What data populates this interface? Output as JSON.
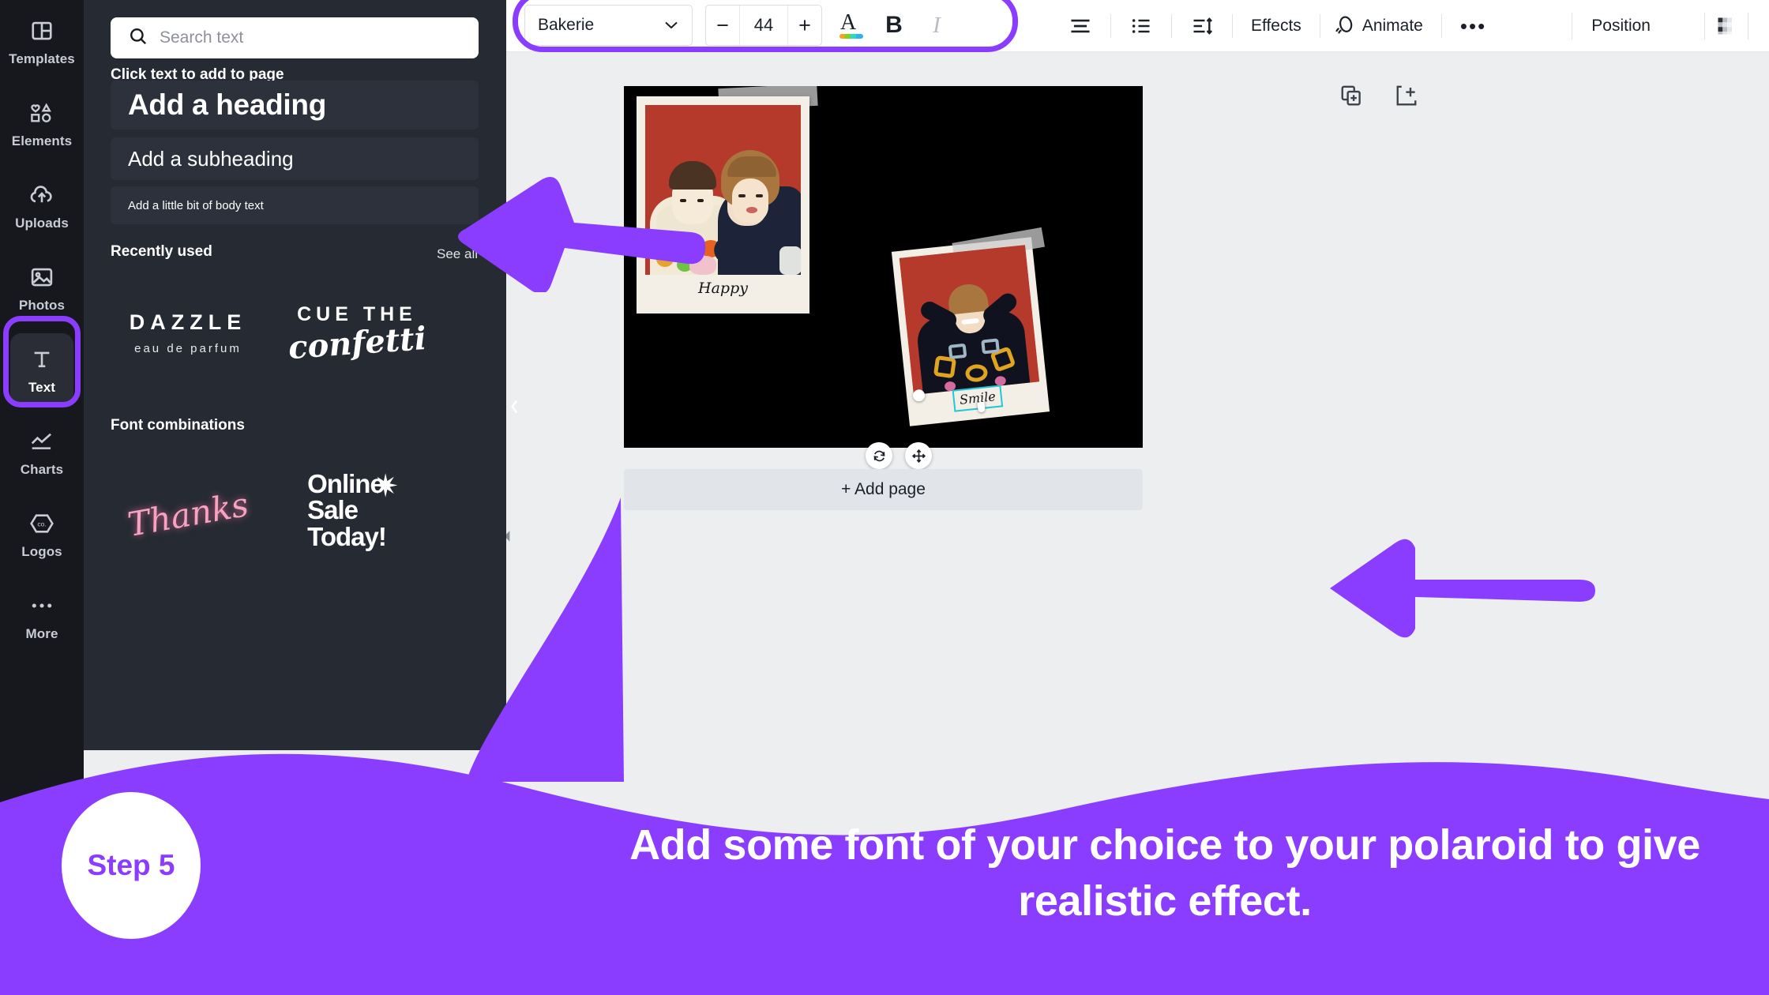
{
  "rail": {
    "items": [
      {
        "label": "Templates",
        "icon": "templates-icon",
        "active": false
      },
      {
        "label": "Elements",
        "icon": "elements-icon",
        "active": false
      },
      {
        "label": "Uploads",
        "icon": "uploads-icon",
        "active": false
      },
      {
        "label": "Photos",
        "icon": "photos-icon",
        "active": false
      },
      {
        "label": "Text",
        "icon": "text-icon",
        "active": true
      },
      {
        "label": "Charts",
        "icon": "charts-icon",
        "active": false
      },
      {
        "label": "Logos",
        "icon": "logos-icon",
        "active": false
      },
      {
        "label": "More",
        "icon": "more-icon",
        "active": false
      }
    ],
    "highlight_color": "#8b3dff"
  },
  "panel": {
    "search_placeholder": "Search text",
    "search_value": "",
    "click_hint": "Click text to add to page",
    "cards": {
      "heading": "Add a heading",
      "subheading": "Add a subheading",
      "body": "Add a little bit of body text"
    },
    "recently_used": {
      "title": "Recently used",
      "see_all": "See all",
      "items": [
        {
          "main": "DAZZLE",
          "sub": "eau de parfum"
        },
        {
          "main": "CUE THE",
          "sub": "confetti"
        }
      ]
    },
    "font_combinations": {
      "title": "Font combinations",
      "items": [
        {
          "main": "Thanks",
          "sub": ""
        },
        {
          "main": "Online\nSale\nToday!",
          "sub": ""
        }
      ]
    }
  },
  "toolbar": {
    "font_family": "Bakerie",
    "font_size": "44",
    "decrease_label": "−",
    "increase_label": "+",
    "bold_label": "B",
    "italic_label": "I",
    "text_color_label": "A",
    "effects_label": "Effects",
    "animate_label": "Animate",
    "more_label": "•••",
    "position_label": "Position",
    "highlight_color": "#8b3dff"
  },
  "canvas": {
    "add_page_label": "+ Add page",
    "duplicate_page_icon": "duplicate-page-icon",
    "add_page_icon": "add-page-icon",
    "design": {
      "background": "#000000",
      "polaroids": [
        {
          "caption": "Happy",
          "photo_bg": "#b53a2c"
        },
        {
          "caption": "Smile",
          "photo_bg": "#b53a2c",
          "selected": true
        }
      ]
    }
  },
  "annotation": {
    "step_label": "Step 5",
    "caption": "Add some font of your choice to your polaroid to give realistic effect.",
    "accent_color": "#8b3dff",
    "arrows": [
      {
        "name": "arrow-to-text-panel",
        "direction": "left"
      },
      {
        "name": "arrow-to-smile-text",
        "direction": "left"
      }
    ]
  }
}
